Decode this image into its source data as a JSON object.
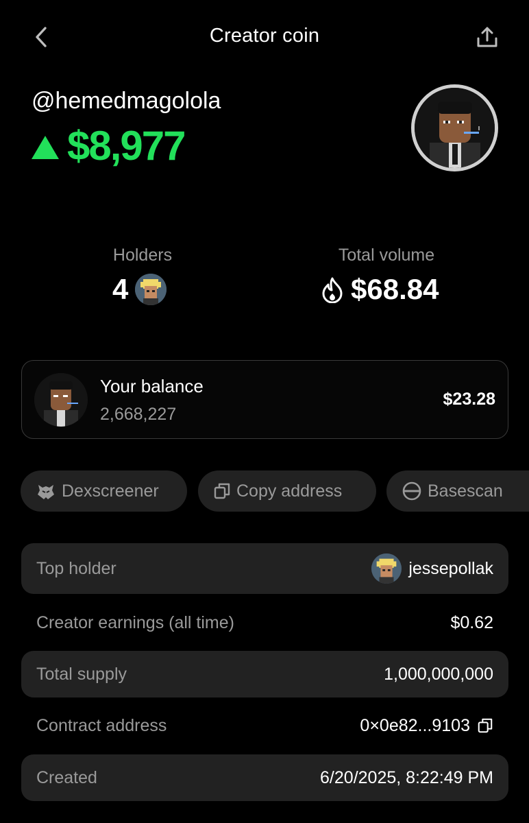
{
  "header": {
    "title": "Creator coin",
    "back_icon": "chevron-left-icon",
    "share_icon": "share-icon"
  },
  "profile": {
    "handle": "@hemedmagolola",
    "price": "$8,977",
    "trend": "up",
    "accent_color": "#22e05a"
  },
  "stats": {
    "holders_label": "Holders",
    "holders_value": "4",
    "volume_label": "Total volume",
    "volume_value": "$68.84"
  },
  "balance": {
    "label": "Your balance",
    "amount": "2,668,227",
    "usd": "$23.28"
  },
  "actions": [
    {
      "label": "Dexscreener",
      "icon": "dexscreener-icon"
    },
    {
      "label": "Copy address",
      "icon": "copy-icon"
    },
    {
      "label": "Basescan",
      "icon": "basescan-icon"
    }
  ],
  "details": {
    "top_holder_label": "Top holder",
    "top_holder_value": "jessepollak",
    "earnings_label": "Creator earnings (all time)",
    "earnings_value": "$0.62",
    "supply_label": "Total supply",
    "supply_value": "1,000,000,000",
    "contract_label": "Contract address",
    "contract_value": "0×0e82...9103",
    "created_label": "Created",
    "created_value": "6/20/2025, 8:22:49 PM"
  }
}
